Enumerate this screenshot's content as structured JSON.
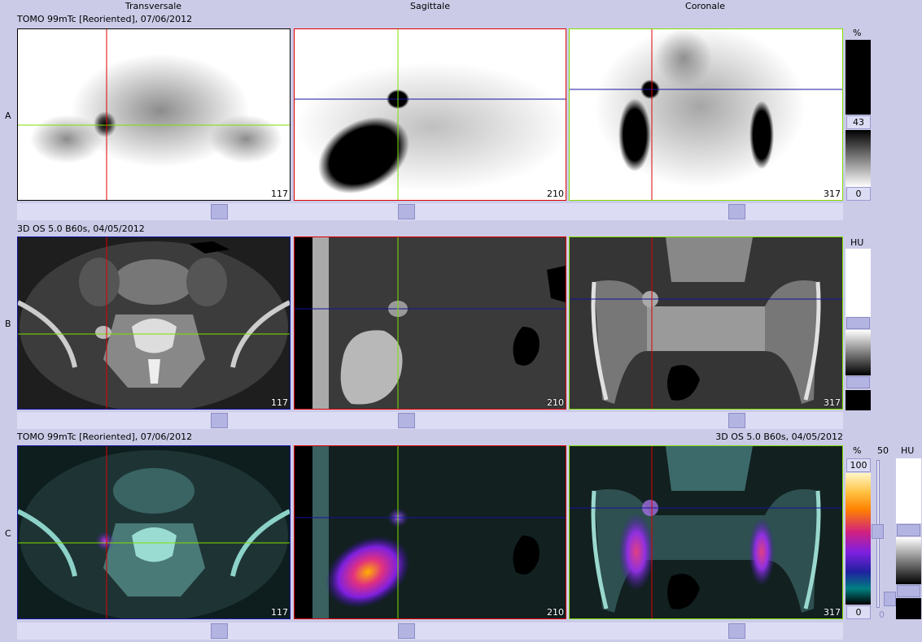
{
  "columns": [
    "Transversale",
    "Sagittale",
    "Coronale"
  ],
  "rows": {
    "a": {
      "label": "A",
      "series_left": "TOMO 99mTc [Reoriented], 07/06/2012"
    },
    "b": {
      "label": "B",
      "series_left": "3D  OS  5.0  B60s, 04/05/2012"
    },
    "c": {
      "label": "C",
      "series_left": "TOMO 99mTc [Reoriented], 07/06/2012",
      "series_right": "3D  OS  5.0  B60s, 04/05/2012"
    }
  },
  "slices": {
    "transversal": "117",
    "sagittal": "210",
    "coronal": "317"
  },
  "colorbars": {
    "a": {
      "unit": "%",
      "value_upper": "43",
      "value_lower": "0"
    },
    "b": {
      "unit": "HU"
    },
    "c": {
      "unit_pet": "%",
      "unit_ct": "HU",
      "pet_max": "100",
      "pet_min": "0",
      "fusion_max": "50",
      "fusion_min": "0"
    }
  },
  "colors": {
    "red": "#e00000",
    "green": "#80e000",
    "blue": "#1414a0",
    "background": "#cbcbe8"
  },
  "icons": {
    "cursor": "crosshair"
  }
}
